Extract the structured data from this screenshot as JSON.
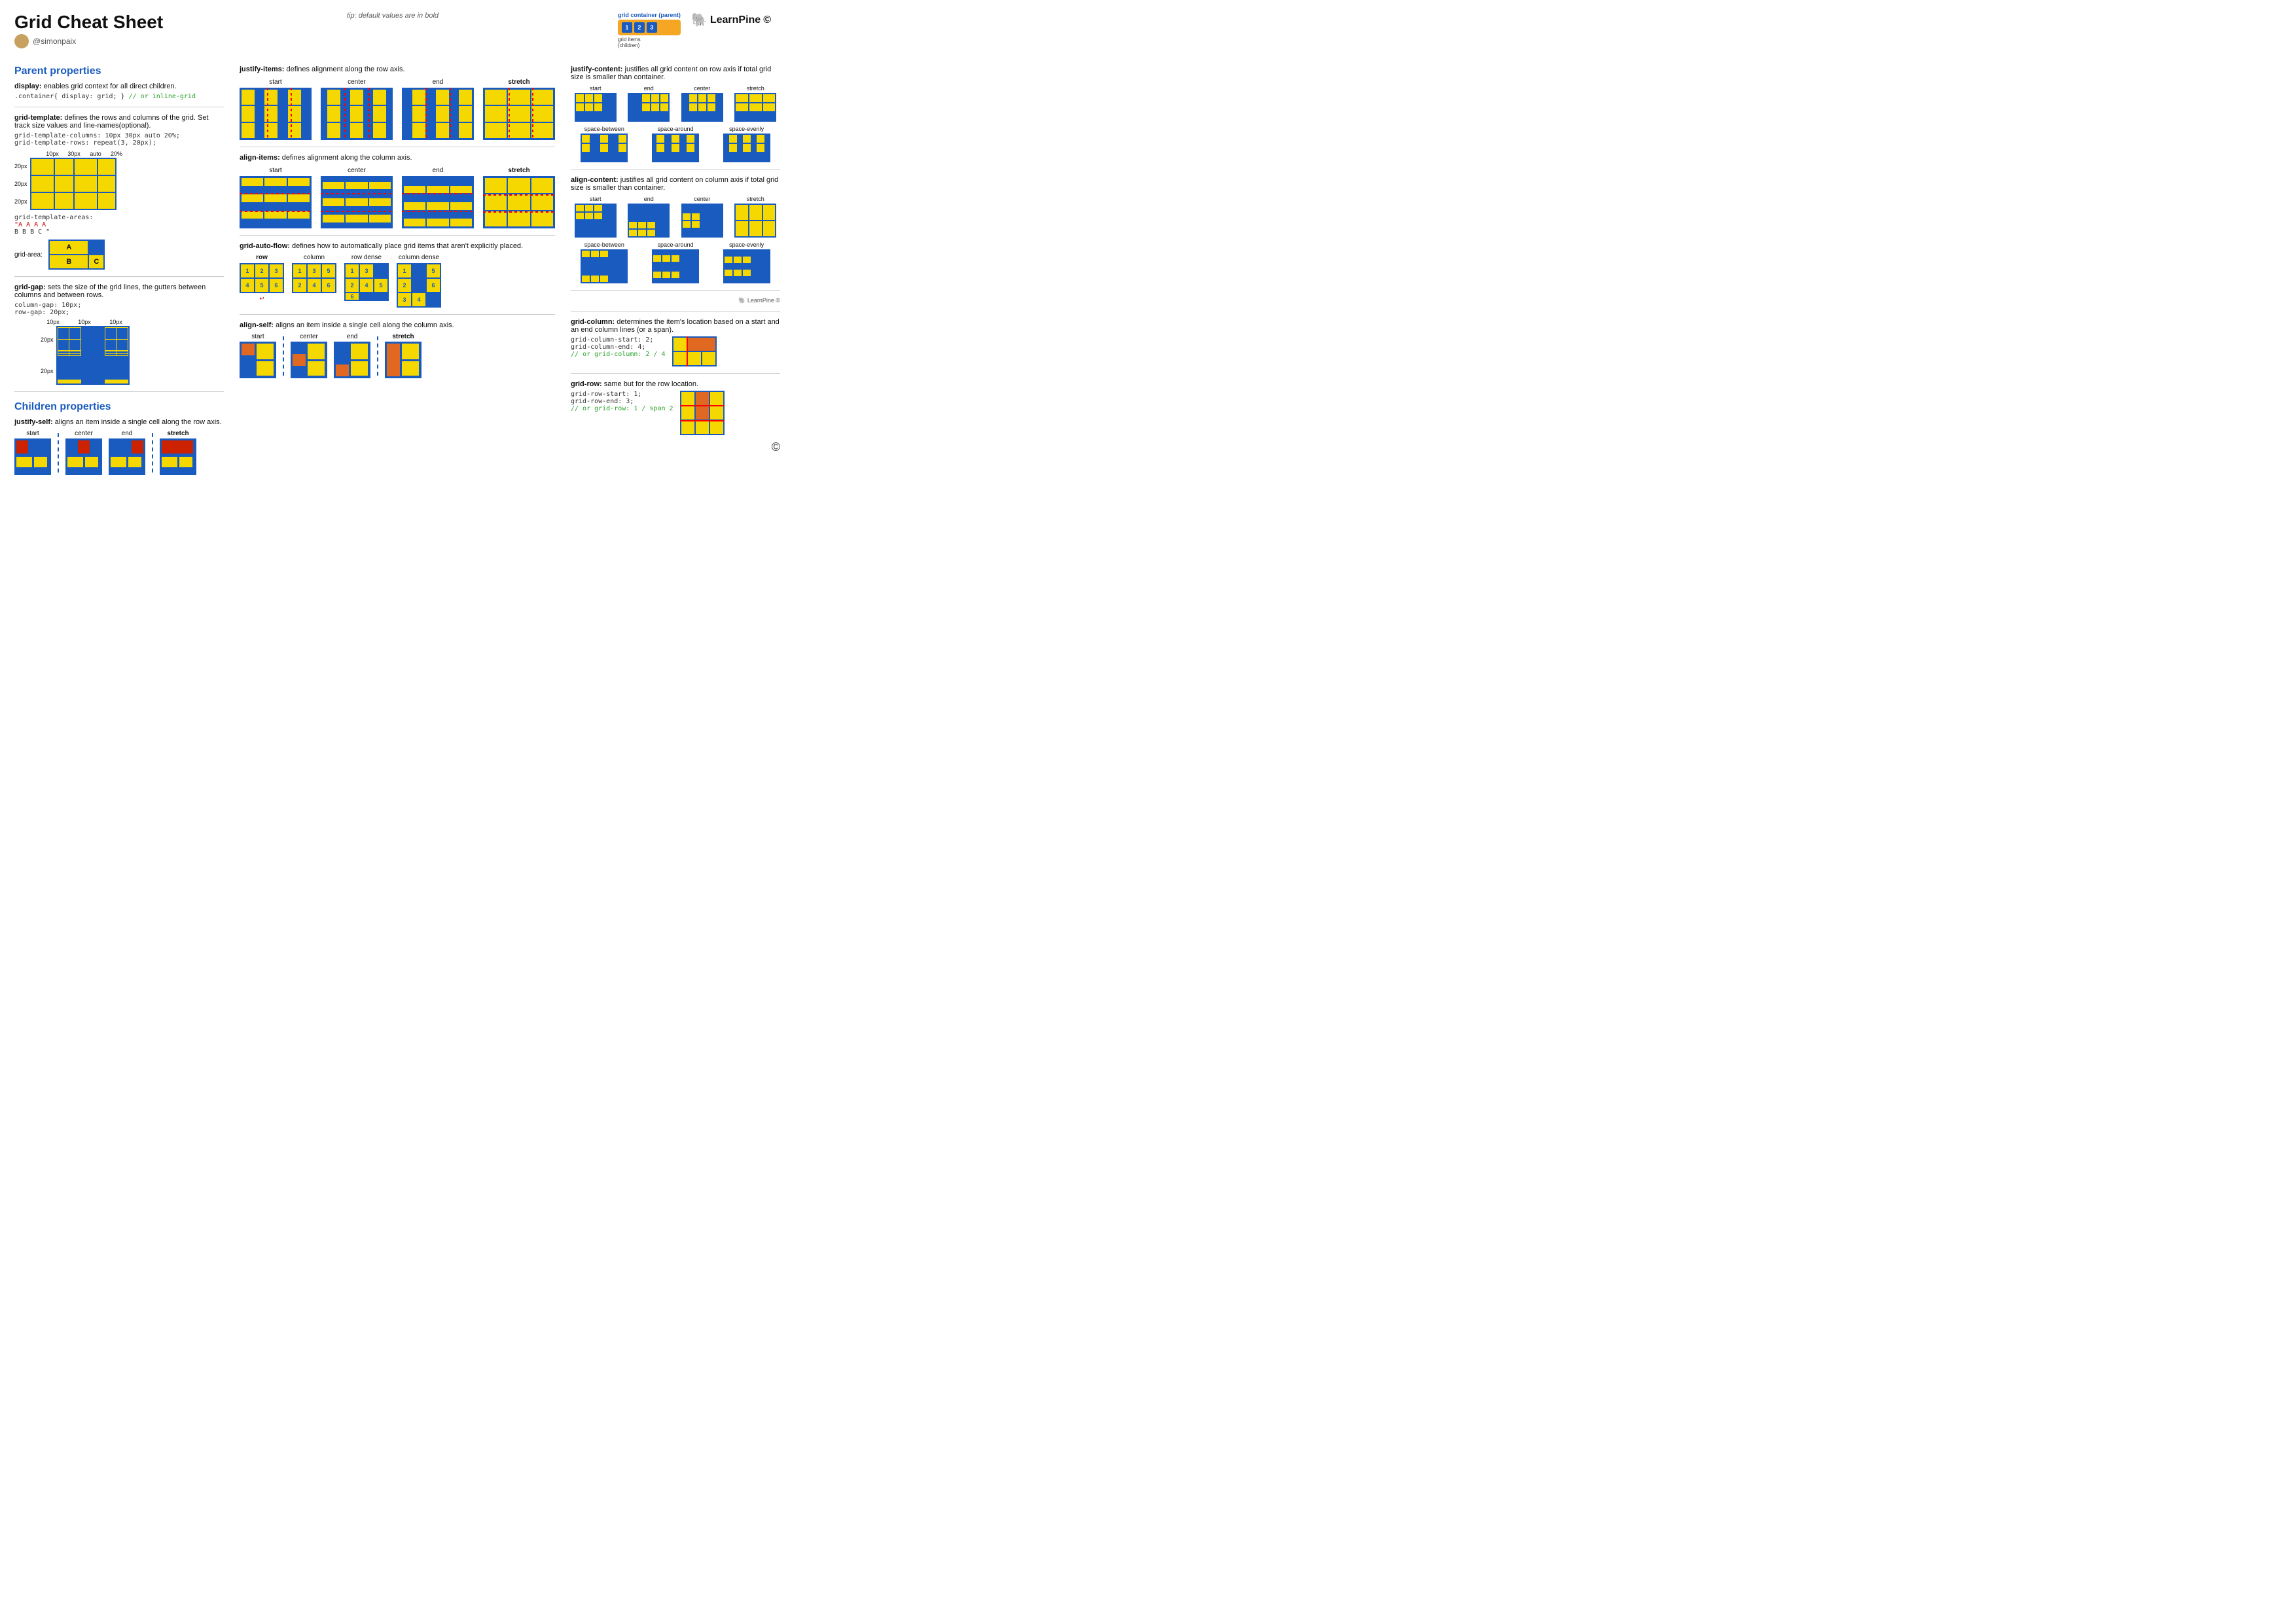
{
  "title": "Grid Cheat Sheet",
  "author": "@simonpaix",
  "tip": "tip: default values are in bold",
  "logo": "LearnPine",
  "copyright": "©",
  "header_diagram": {
    "label": "grid container (parent)",
    "items": [
      "1",
      "2",
      "3"
    ],
    "sublabel": "grid items\n(children)"
  },
  "parent_section": {
    "title": "Parent properties",
    "display": {
      "title": "display:",
      "desc": "enables grid context for all direct children.",
      "code": ".container{ display: grid; }",
      "code_comment": "// or inline-grid"
    },
    "grid_template": {
      "title": "grid-template:",
      "desc": "defines the rows and columns of the grid. Set track size values and line-names(optional).",
      "code1": "grid-template-columns: 10px 30px auto 20%;",
      "code2": "grid-template-rows: repeat(3, 20px);",
      "col_labels": [
        "10px",
        "30px",
        "auto",
        "20%"
      ],
      "row_labels": [
        "20px",
        "20px",
        "20px"
      ],
      "areas_title": "grid-template-areas:",
      "areas_code1": "\"A A A A",
      "areas_code2": " B B B C \"",
      "grid_area_label": "grid-area:",
      "grid_area_a": "A",
      "grid_area_b": "B",
      "grid_area_c": "C"
    },
    "grid_gap": {
      "title": "grid-gap:",
      "desc": "sets the size of the grid lines, the gutters between columns and between rows.",
      "code1": "column-gap: 10px;",
      "code2": "row-gap: 20px;",
      "col_labels": [
        "10px",
        "10px",
        "10px"
      ],
      "row_labels": [
        "20px",
        "20px"
      ]
    }
  },
  "middle_section": {
    "justify_items": {
      "title": "justify-items:",
      "desc": "defines alignment along the row axis.",
      "items": [
        {
          "label": "start",
          "bold": false
        },
        {
          "label": "center",
          "bold": false
        },
        {
          "label": "end",
          "bold": false
        },
        {
          "label": "stretch",
          "bold": true
        }
      ]
    },
    "align_items": {
      "title": "align-items:",
      "desc": "defines alignment along the column axis.",
      "items": [
        {
          "label": "start",
          "bold": false
        },
        {
          "label": "center",
          "bold": false
        },
        {
          "label": "end",
          "bold": false
        },
        {
          "label": "stretch",
          "bold": true
        }
      ]
    },
    "grid_auto_flow": {
      "title": "grid-auto-flow:",
      "desc": "defines how to automatically place grid items that aren't explicitly placed.",
      "items": [
        {
          "label": "row",
          "bold": true
        },
        {
          "label": "column",
          "bold": false
        },
        {
          "label": "row dense",
          "bold": false
        },
        {
          "label": "column dense",
          "bold": false
        }
      ]
    }
  },
  "right_section": {
    "justify_content": {
      "title": "justify-content:",
      "desc": "justifies all grid content on row axis if total grid size is smaller than container.",
      "items": [
        {
          "label": "start"
        },
        {
          "label": "end"
        },
        {
          "label": "center"
        },
        {
          "label": "stretch"
        },
        {
          "label": "space-between"
        },
        {
          "label": "space-around"
        },
        {
          "label": "space-evenly"
        }
      ]
    },
    "align_content": {
      "title": "align-content:",
      "desc": "justifies all grid content on column axis if total grid size is smaller than container.",
      "items": [
        {
          "label": "start"
        },
        {
          "label": "end"
        },
        {
          "label": "center"
        },
        {
          "label": "stretch"
        },
        {
          "label": "space-between"
        },
        {
          "label": "space-around"
        },
        {
          "label": "space-evenly"
        }
      ]
    }
  },
  "children_section": {
    "title": "Children properties",
    "justify_self": {
      "title": "justify-self:",
      "desc": "aligns an item inside a single cell along the row axis.",
      "items": [
        {
          "label": "start",
          "bold": false
        },
        {
          "label": "center",
          "bold": false
        },
        {
          "label": "end",
          "bold": false
        },
        {
          "label": "stretch",
          "bold": true
        }
      ]
    },
    "align_self": {
      "title": "align-self:",
      "desc": "aligns an item inside a single cell along the column axis.",
      "items": [
        {
          "label": "start",
          "bold": false
        },
        {
          "label": "center",
          "bold": false
        },
        {
          "label": "end",
          "bold": false
        },
        {
          "label": "stretch",
          "bold": true
        }
      ]
    },
    "grid_column": {
      "title": "grid-column:",
      "desc": "determines the item's location based on a start and an end column lines (or a span).",
      "code1": "grid-column-start: 2;",
      "code2": "grid-column-end: 4;",
      "code3": "// or grid-column: 2 / 4"
    },
    "grid_row": {
      "title": "grid-row:",
      "desc": "same but for the row location.",
      "code1": "grid-row-start: 1;",
      "code2": "grid-row-end: 3;",
      "code3": "// or grid-row: 1 / span 2"
    }
  }
}
